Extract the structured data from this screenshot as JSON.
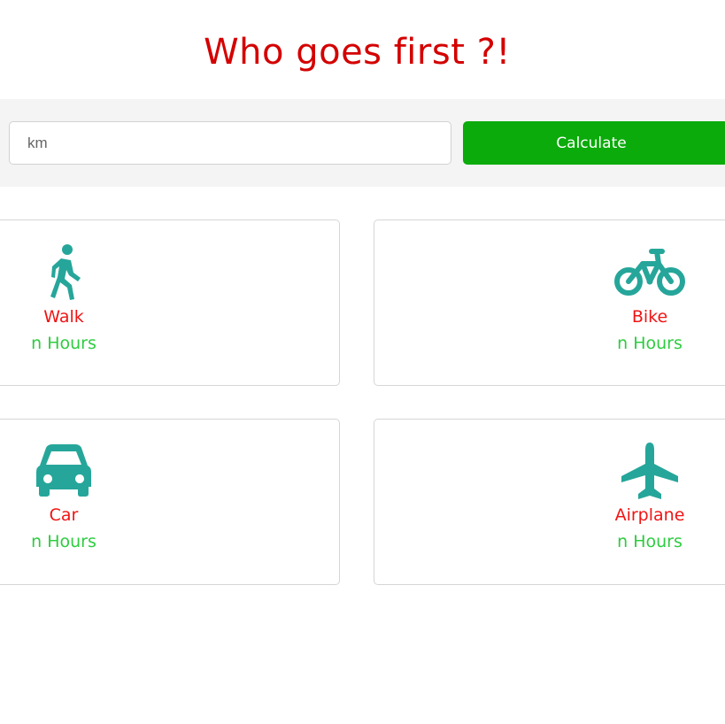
{
  "header": {
    "title": "Who goes first ?!"
  },
  "form": {
    "distance_placeholder": "km",
    "calculate_label": "Calculate"
  },
  "vehicles": [
    {
      "name": "Walk",
      "time": "n Hours",
      "icon": "walking-icon"
    },
    {
      "name": "Bike",
      "time": "n Hours",
      "icon": "bicycle-icon"
    },
    {
      "name": "Car",
      "time": "n Hours",
      "icon": "car-icon"
    },
    {
      "name": "Airplane",
      "time": "n Hours",
      "icon": "airplane-icon"
    }
  ],
  "colors": {
    "title": "#d40000",
    "button": "#0aab0a",
    "icon": "#26a69a",
    "vehicle_name": "#f01414",
    "vehicle_time": "#2ecc40"
  }
}
